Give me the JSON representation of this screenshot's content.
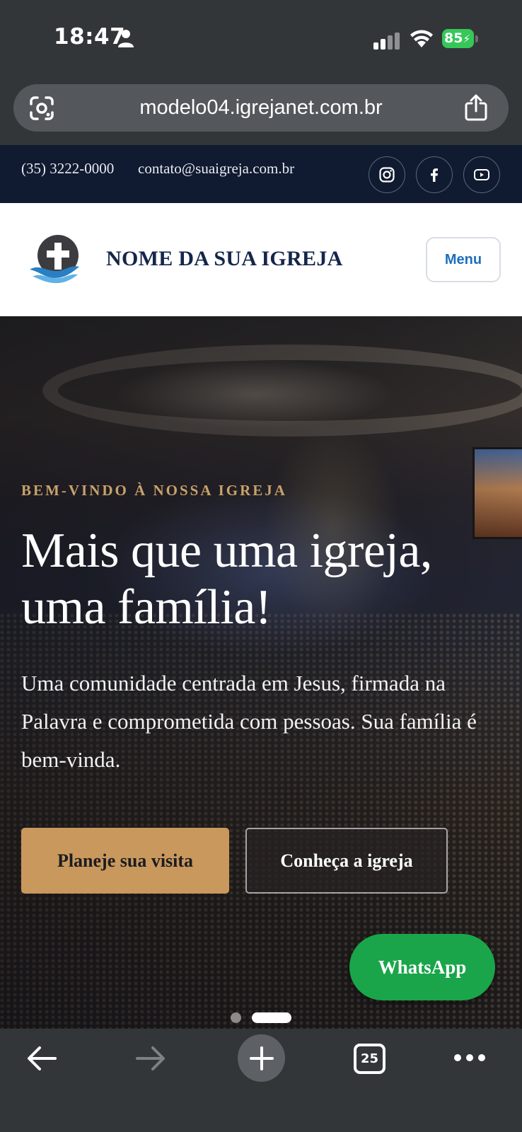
{
  "status_bar": {
    "time": "18:47",
    "battery": "85",
    "icons": [
      "person-icon",
      "cellular-signal-icon",
      "wifi-icon",
      "battery-charging-icon"
    ]
  },
  "browser": {
    "url": "modelo04.igrejanet.com.br",
    "icons": [
      "google-lens-icon",
      "share-icon"
    ],
    "toolbar": {
      "tab_count": "25",
      "icons": [
        "back-arrow-icon",
        "forward-arrow-icon",
        "new-tab-plus-icon",
        "tabs-icon",
        "more-dots-icon"
      ]
    }
  },
  "topbar": {
    "phone": "(35) 3222-0000",
    "email": "contato@suaigreja.com.br",
    "social": [
      "instagram-icon",
      "facebook-icon",
      "youtube-icon"
    ]
  },
  "header": {
    "church_name": "NOME DA SUA IGREJA",
    "menu_label": "Menu"
  },
  "hero": {
    "eyebrow": "BEM-VINDO À NOSSA IGREJA",
    "title_line1": "Mais que uma igreja,",
    "title_line2": "uma família!",
    "text": "Uma comunidade centrada em Jesus, firmada na Palavra e comprometida com pessoas. Sua família é bem-vinda.",
    "primary_button": "Planeje sua visita",
    "secondary_button": "Conheça a igreja",
    "whatsapp_button": "WhatsApp"
  },
  "colors": {
    "topbar_bg": "#101a30",
    "brand_navy": "#15264a",
    "accent_gold": "#c9985c",
    "whatsapp_green": "#1aa54a",
    "menu_blue": "#1d6fbf"
  }
}
